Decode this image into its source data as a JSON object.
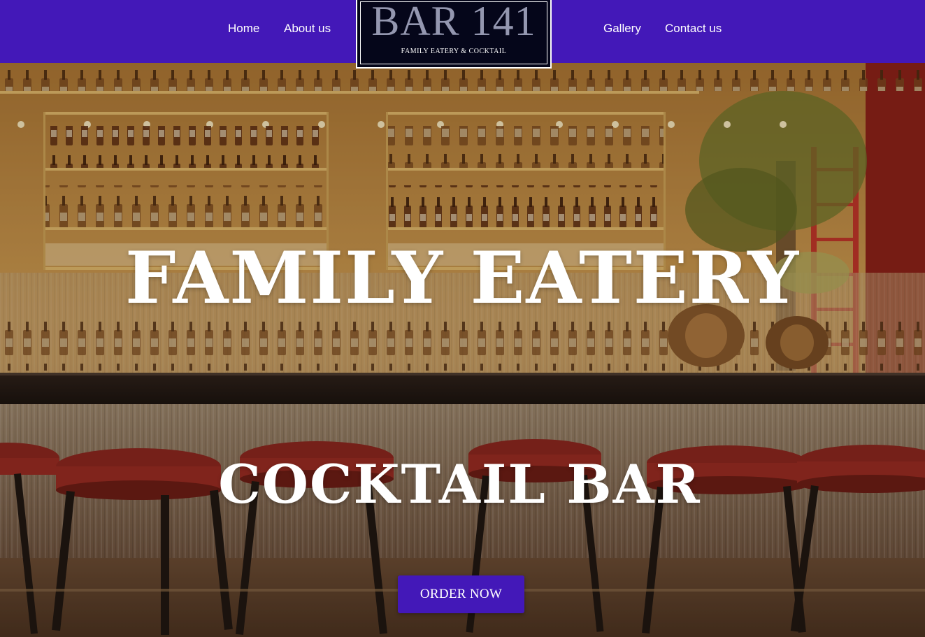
{
  "nav": {
    "home": "Home",
    "about": "About us",
    "gallery": "Gallery",
    "contact": "Contact us"
  },
  "logo": {
    "title": "BAR 141",
    "subtitle": "FAMILY EATERY & COCKTAIL"
  },
  "hero": {
    "line1": "FAMILY EATERY",
    "line2": "COCKTAIL BAR",
    "cta": "ORDER NOW"
  },
  "colors": {
    "brand_purple": "#4318b8",
    "logo_bg": "#05061a",
    "logo_title": "#9497b0",
    "text_light": "#ffffff",
    "stool_red": "#9c2a22",
    "bar_top": "#241a15"
  }
}
